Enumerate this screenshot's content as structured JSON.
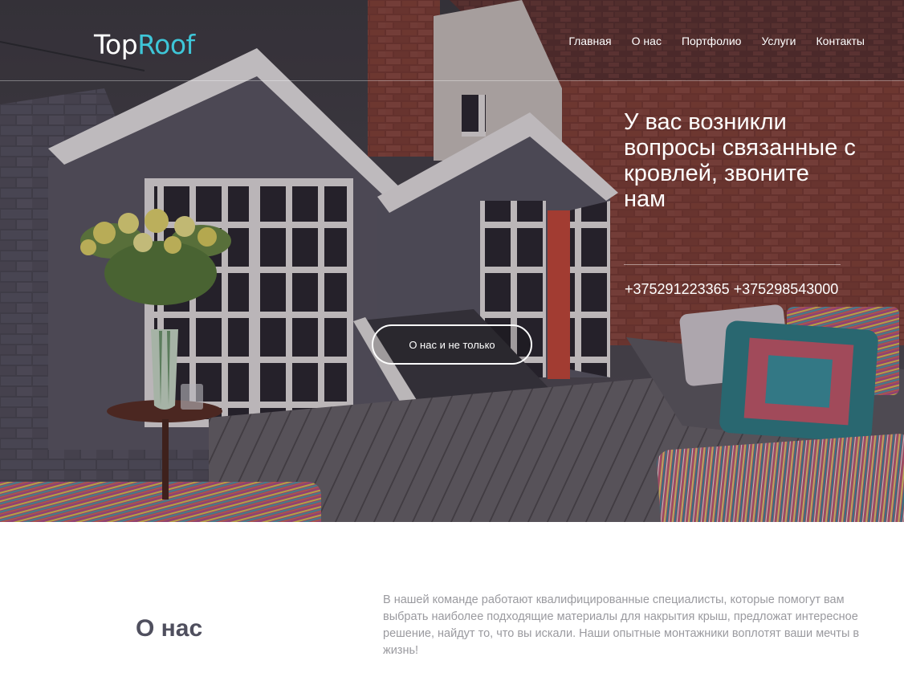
{
  "brand": {
    "logo_part1": "Top",
    "logo_part2": "Roof",
    "accent_color": "#3ec6d8"
  },
  "nav": {
    "items": [
      {
        "label": "Главная"
      },
      {
        "label": "О нас"
      },
      {
        "label": "Портфолио"
      },
      {
        "label": "Услуги"
      },
      {
        "label": "Контакты"
      }
    ]
  },
  "hero": {
    "title": "У вас возникли вопросы связанные с кровлей, звоните нам",
    "phones": "+375291223365 +375298543000",
    "button_label": "О нас и не только"
  },
  "about": {
    "title": "О нас",
    "text": "В нашей команде работают квалифицированные специалисты, которые помогут вам выбрать наиболее подходящие материалы для накрытия крыш, предложат интересное решение, найдут то, что вы искали. Наши опытные монтажники воплотят ваши мечты в жизнь!"
  }
}
